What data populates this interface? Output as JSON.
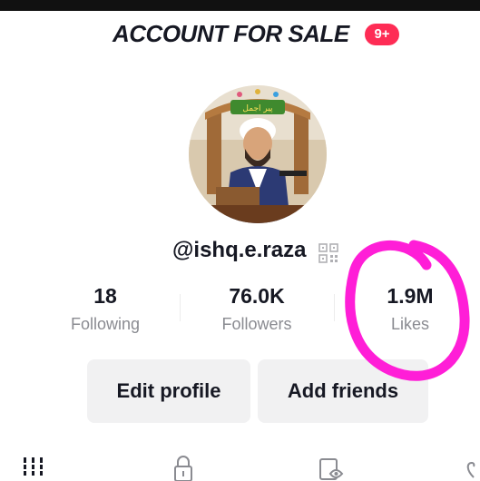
{
  "header": {
    "title": "ACCOUNT FOR SALE",
    "badge": "9+"
  },
  "profile": {
    "username": "@ishq.e.raza",
    "avatar_banner_text": "پیر اجمل"
  },
  "stats": [
    {
      "value": "18",
      "label": "Following"
    },
    {
      "value": "76.0K",
      "label": "Followers"
    },
    {
      "value": "1.9M",
      "label": "Likes"
    }
  ],
  "buttons": {
    "edit_profile": "Edit profile",
    "add_friends": "Add friends"
  },
  "tabs": [
    {
      "icon": "grid-icon"
    },
    {
      "icon": "lock-icon"
    },
    {
      "icon": "tagged-icon"
    },
    {
      "icon": "heart-icon"
    }
  ],
  "colors": {
    "badge": "#fe2c55",
    "annotation": "#ff1ed7",
    "button_bg": "#f1f1f2",
    "secondary_text": "#8a8b91"
  }
}
